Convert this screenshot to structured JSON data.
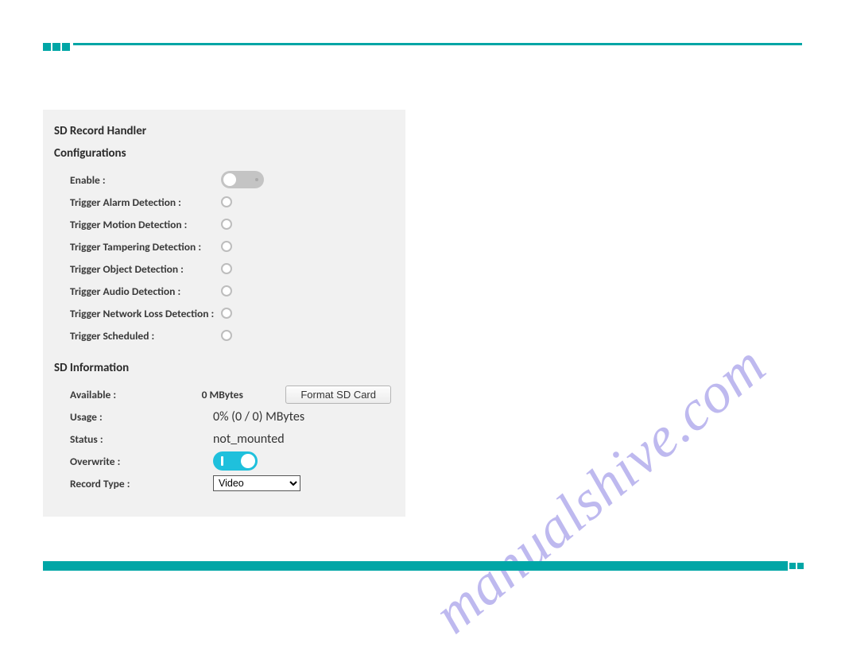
{
  "panel": {
    "title": "SD Record Handler",
    "configurations_label": "Configurations",
    "enable_label": "Enable :",
    "triggers": {
      "alarm": "Trigger Alarm Detection :",
      "motion": "Trigger Motion Detection :",
      "tampering": "Trigger Tampering Detection :",
      "object": "Trigger Object Detection :",
      "audio": "Trigger Audio Detection :",
      "network": "Trigger Network Loss Detection :",
      "scheduled": "Trigger Scheduled :"
    },
    "sd_info_label": "SD Information",
    "available_label": "Available :",
    "available_value": "0 MBytes",
    "format_button": "Format SD Card",
    "usage_label": "Usage :",
    "usage_value": "0% (0 / 0) MBytes",
    "status_label": "Status :",
    "status_value": "not_mounted",
    "overwrite_label": "Overwrite :",
    "record_type_label": "Record Type :",
    "record_type_value": "Video"
  },
  "watermark": "manualshive.com"
}
